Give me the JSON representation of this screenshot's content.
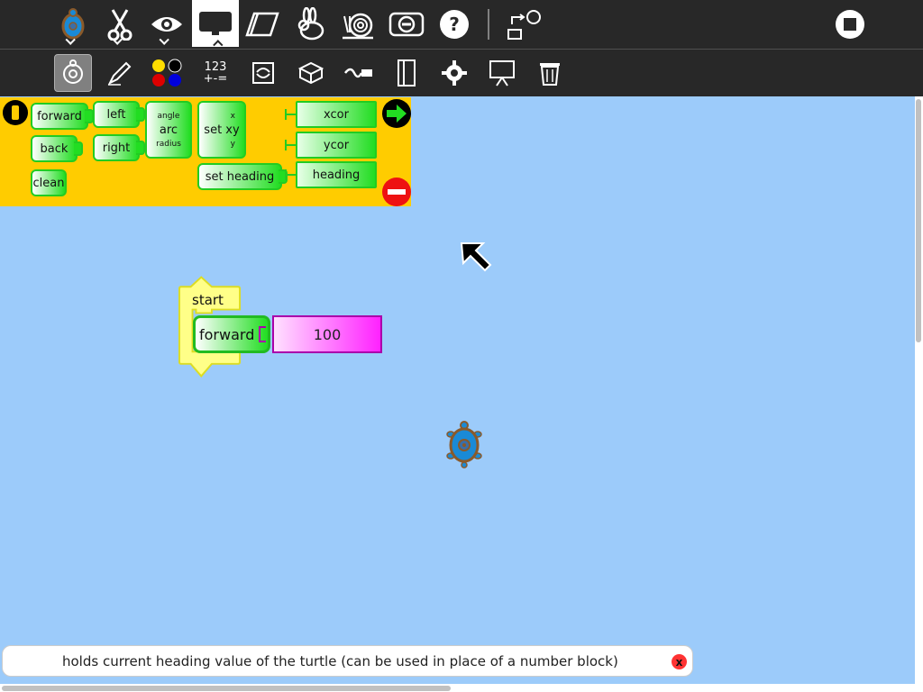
{
  "toolbar": {
    "items": [
      "turtle-activity",
      "edit",
      "view",
      "project",
      "erase",
      "run-fast",
      "run-slow",
      "hide-blocks",
      "help",
      "share-turtle"
    ]
  },
  "toolbar2": {
    "number_label_top": "123",
    "number_label_bottom": "+-="
  },
  "palette": {
    "blocks": {
      "forward": "forward",
      "left": "left",
      "back": "back",
      "right": "right",
      "clean": "clean",
      "arc_angle": "angle",
      "arc": "arc",
      "arc_radius": "radius",
      "setxy": "set xy",
      "setxy_x": "x",
      "setxy_y": "y",
      "set_heading": "set heading",
      "xcor": "xcor",
      "ycor": "ycor",
      "heading": "heading"
    }
  },
  "program": {
    "start_label": "start",
    "forward_label": "forward",
    "forward_value": "100"
  },
  "help": {
    "text": "holds current heading value of the turtle (can be used in place of a number block)",
    "close_label": "x"
  },
  "colors": {
    "canvas": "#9ccbfa",
    "palette_bg": "#ffcc00",
    "block_green": "#22dd22",
    "number_magenta": "#ff22ff",
    "toolbar": "#282828"
  }
}
